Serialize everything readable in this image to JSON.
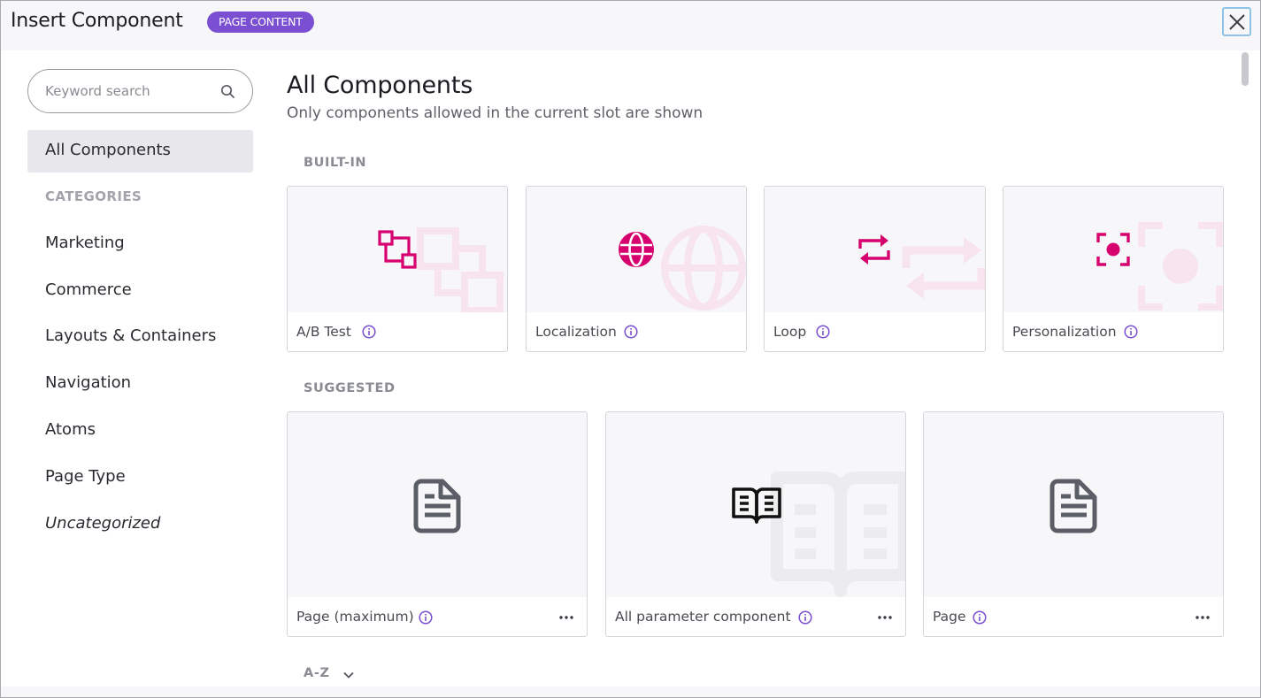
{
  "dialog": {
    "title": "Insert Component",
    "badge": "PAGE CONTENT",
    "close_icon": "close-icon"
  },
  "sidebar": {
    "search_placeholder": "Keyword search",
    "all_components": "All Components",
    "categories_heading": "CATEGORIES",
    "categories": [
      "Marketing",
      "Commerce",
      "Layouts & Containers",
      "Navigation",
      "Atoms",
      "Page Type",
      "Uncategorized"
    ]
  },
  "main": {
    "title": "All Components",
    "subtitle": "Only components allowed in the current slot are shown",
    "built_in_label": "BUILT-IN",
    "built_in": [
      {
        "label": "A/B Test",
        "icon": "ab-test-icon"
      },
      {
        "label": "Localization",
        "icon": "globe-icon"
      },
      {
        "label": "Loop",
        "icon": "loop-icon"
      },
      {
        "label": "Personalization",
        "icon": "personalization-icon"
      }
    ],
    "suggested_label": "SUGGESTED",
    "suggested": [
      {
        "label": "Page (maximum)",
        "icon": "document-icon"
      },
      {
        "label": "All parameter component",
        "icon": "book-icon"
      },
      {
        "label": "Page",
        "icon": "document-icon"
      }
    ],
    "az_label": "A-Z"
  },
  "colors": {
    "accent": "#d6006e",
    "badge": "#7a4fd1",
    "info_icon": "#7a4fd1"
  }
}
